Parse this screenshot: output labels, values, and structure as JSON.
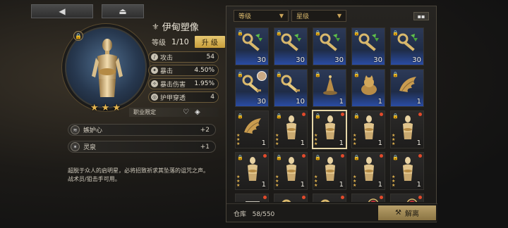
{
  "nav": {
    "back_icon": "◀",
    "home_icon": "⏏"
  },
  "character": {
    "name": "伊甸塑像",
    "level_label": "等级",
    "level_value": "1/10",
    "upgrade_label": "升 级",
    "lock_icon": "lock-icon",
    "stars": 3
  },
  "stats": [
    {
      "label": "攻击",
      "value": "54",
      "icon": "sword-icon"
    },
    {
      "label": "暴击",
      "value": "4.50%",
      "icon": "crit-icon"
    },
    {
      "label": "暴击伤害",
      "value": "1.95%",
      "icon": "crit-damage-icon"
    },
    {
      "label": "护甲穿透",
      "value": "4",
      "icon": "armor-pierce-icon"
    }
  ],
  "job_restriction": {
    "label": "职业限定"
  },
  "skills": [
    {
      "name": "嫉妒心",
      "value": "+2",
      "icon": "wind-icon"
    },
    {
      "name": "灵泉",
      "value": "+1",
      "icon": "spring-icon"
    }
  ],
  "description": {
    "line1": "超脱于众人的启明星，必将招致祈求其坠落的诅咒之声。",
    "line2": "战术员/狙击手可用。"
  },
  "filters": {
    "level": "等级",
    "star": "星级",
    "grid_icon": "grid-view-icon"
  },
  "inventory_rows": [
    [
      {
        "type": "key-green",
        "count": "30",
        "blue": true,
        "lock": true
      },
      {
        "type": "key-green",
        "count": "30",
        "blue": true,
        "lock": true
      },
      {
        "type": "key-green",
        "count": "30",
        "blue": true,
        "lock": true
      },
      {
        "type": "key-green",
        "count": "30",
        "blue": true,
        "lock": true
      },
      {
        "type": "key-green",
        "count": "30",
        "blue": true,
        "lock": true
      }
    ],
    [
      {
        "type": "key-gold",
        "count": "30",
        "blue": true,
        "lock": true,
        "avatar": true
      },
      {
        "type": "key-gold",
        "count": "10",
        "blue": true,
        "lock": true
      },
      {
        "type": "bell",
        "count": "1",
        "blue": true,
        "lock": true
      },
      {
        "type": "cat",
        "count": "1",
        "blue": true,
        "lock": true
      },
      {
        "type": "wing",
        "count": "1",
        "blue": true,
        "lock": true
      }
    ],
    [
      {
        "type": "wing",
        "count": "1",
        "lock": true,
        "stars": 3
      },
      {
        "type": "statue",
        "count": "1",
        "lock": true,
        "stars": 3,
        "dot": true
      },
      {
        "type": "statue",
        "count": "1",
        "lock": true,
        "stars": 3,
        "dot": true,
        "selected": true
      },
      {
        "type": "statue",
        "count": "1",
        "lock": true,
        "stars": 3,
        "dot": true
      },
      {
        "type": "statue",
        "count": "1",
        "lock": true,
        "stars": 3,
        "dot": true
      }
    ],
    [
      {
        "type": "statue",
        "count": "1",
        "lock": true,
        "stars": 3,
        "dot": true
      },
      {
        "type": "statue",
        "count": "1",
        "lock": true,
        "stars": 3,
        "dot": true
      },
      {
        "type": "statue",
        "count": "1",
        "lock": true,
        "stars": 3,
        "dot": true
      },
      {
        "type": "statue",
        "count": "1",
        "lock": true,
        "stars": 3,
        "dot": true
      },
      {
        "type": "statue",
        "count": "1",
        "lock": true,
        "stars": 3,
        "dot": true
      }
    ],
    [
      {
        "type": "shield",
        "count": "",
        "lock": false,
        "dot": true
      },
      {
        "type": "key-gold",
        "count": "",
        "lock": false,
        "dot": true
      },
      {
        "type": "key-gold",
        "count": "",
        "lock": false,
        "dot": true
      },
      {
        "type": "staff",
        "count": "",
        "lock": false,
        "dot": true
      },
      {
        "type": "staff",
        "count": "",
        "lock": false,
        "dot": true
      }
    ]
  ],
  "footer": {
    "storage_label": "仓库",
    "storage_value": "58/550",
    "decompose_label": "解离",
    "decompose_icon": "decompose-icon"
  },
  "colors": {
    "gold": "#e4b54f",
    "accent_button": "#c79d3a",
    "rarity_blue": "#2a4ca3",
    "red_dot": "#e24a2b"
  }
}
